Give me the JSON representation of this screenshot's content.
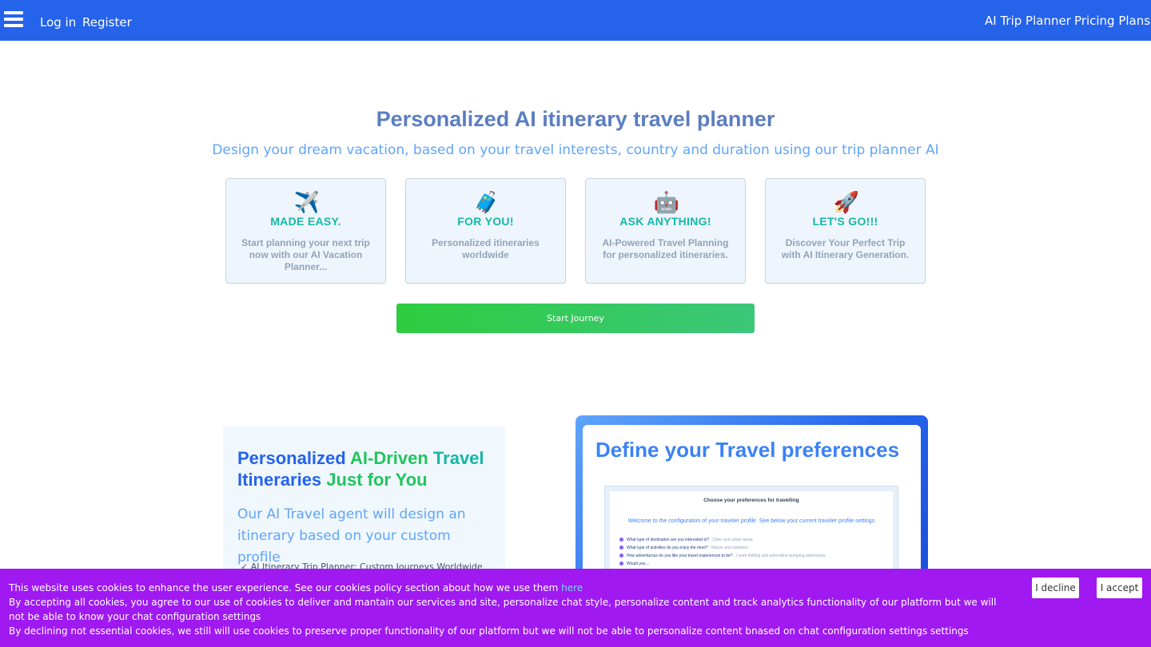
{
  "nav": {
    "login": "Log in",
    "register": "Register",
    "trip_planner": "AI Trip Planner",
    "pricing": "Pricing Plans"
  },
  "hero": {
    "title": "Personalized AI itinerary travel planner",
    "subtitle": "Design your dream vacation, based on your travel interests, country and duration using our trip planner AI"
  },
  "cards": [
    {
      "icon": "airplane-icon",
      "glyph": "✈️",
      "title": "MADE EASY.",
      "desc": "Start planning your next trip now with our AI Vacation Planner..."
    },
    {
      "icon": "luggage-icon",
      "glyph": "🧳",
      "title": "FOR YOU!",
      "desc": "Personalized itineraries worldwide"
    },
    {
      "icon": "robot-icon",
      "glyph": "🤖",
      "title": "ASK ANYTHING!",
      "desc": "AI-Powered Travel Planning for personalized itineraries."
    },
    {
      "icon": "rocket-icon",
      "glyph": "🚀",
      "title": "LET'S GO!!!",
      "desc": "Discover Your Perfect Trip with AI Itinerary Generation."
    }
  ],
  "start_button": "Start Journey",
  "feature": {
    "title_1": "Personalized ",
    "title_2": "AI-Driven",
    "title_3": " Travel",
    "title_4": "Itineraries ",
    "title_5": "Just for You",
    "subtitle": "Our AI Travel agent will design an itinerary based on your custom profile",
    "line": "✓ AI Itinerary Trip Planner: Custom Journeys Worldwide"
  },
  "preferences": {
    "title": "Define your Travel preferences",
    "shot_heading": "Choose your preferences for travelling",
    "shot_welcome": "Welcome to the configuration of your traveler profile. See below your current traveler profile settings",
    "q1": "What type of destination are you interested in? ",
    "a1": ": Cities and urban areas.",
    "q2": "What type of activities do you enjoy the most? ",
    "a2": ": Nature and outdoors.",
    "q3": "How adventurous do you like your travel experiences to be? ",
    "a3": ": I seek thrilling and adrenaline-pumping adventures",
    "q4": "Would you ...",
    "a4": ""
  },
  "cookies": {
    "line1": "This website uses cookies to enhance the user experience. See our cookies policy section about how we use them ",
    "link": "here",
    "line2": "By accepting all cookies, you agree to our use of cookies to deliver and mantain our services and site, personalize chat style, personalize content and track analytics functionality of our platform but we will not be able to know your chat configuration settings",
    "line3": "By declining not essential cookies, we still will use cookies to preserve proper functionality of our platform but we will not be able to personalize content bnased on chat configuration settings settings",
    "decline": "I decline",
    "accept": "I accept"
  },
  "colors": {
    "nav_bg": "#2563eb",
    "cookie_bg": "#9f19f0",
    "start_button": "#2ecc40",
    "card_title": "#14b8a6"
  }
}
